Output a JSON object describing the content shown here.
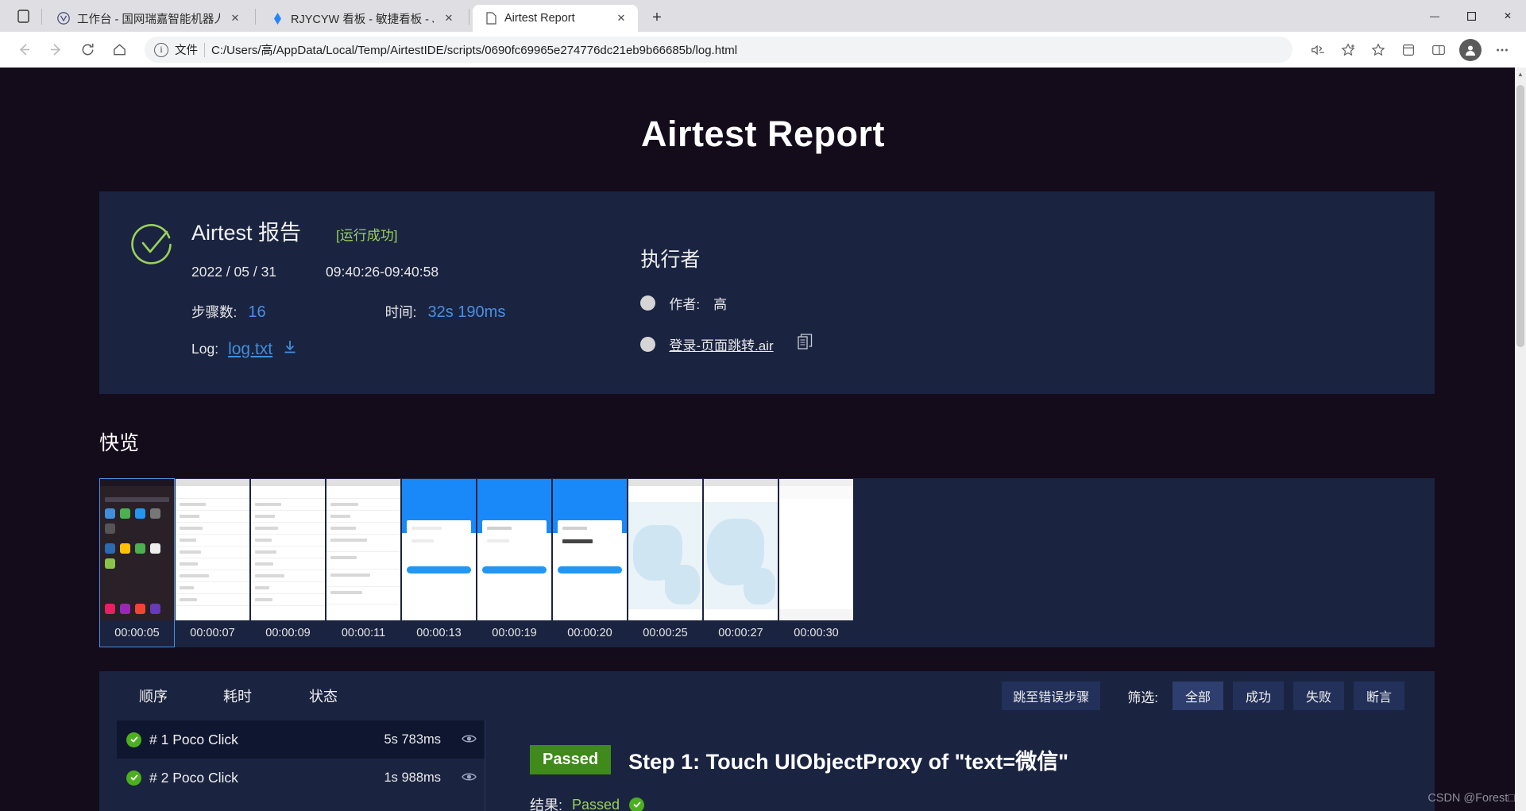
{
  "browser": {
    "tabs": [
      {
        "title": "工作台 - 国网瑞嘉智能机器人云平",
        "active": false,
        "favicon": "vue-logo-icon"
      },
      {
        "title": "RJYCYW 看板 - 敏捷看板 - Jira",
        "active": false,
        "favicon": "jira-logo-icon"
      },
      {
        "title": "Airtest Report",
        "active": true,
        "favicon": "page-icon"
      }
    ],
    "new_tab_label": "+",
    "window_controls": {
      "minimize": "—",
      "maximize": "☐",
      "close": "✕"
    },
    "omnibox": {
      "scheme_label": "文件",
      "url": "C:/Users/高/AppData/Local/Temp/AirtestIDE/scripts/0690fc69965e274776dc21eb9b66685b/log.html"
    },
    "nav": {
      "back": "←",
      "forward": "→",
      "reload": "↻",
      "home": "⌂"
    }
  },
  "report": {
    "page_title": "Airtest Report",
    "summary": {
      "title": "Airtest 报告",
      "status": "[运行成功]",
      "date": "2022 / 05 / 31",
      "time_range": "09:40:26-09:40:58",
      "steps_label": "步骤数:",
      "steps_value": "16",
      "duration_label": "时间:",
      "duration_value": "32s 190ms",
      "log_label": "Log:",
      "log_file": "log.txt",
      "download_icon": "download-icon",
      "check_icon": "success-check-icon"
    },
    "executor": {
      "title": "执行者",
      "author_label": "作者:",
      "author_value": "高",
      "script_name": "登录-页面跳转.air",
      "copy_icon": "copy-icon"
    }
  },
  "snapshot": {
    "title": "快览",
    "thumbs": [
      {
        "time": "00:00:05",
        "kind": "home",
        "active": true
      },
      {
        "time": "00:00:07",
        "kind": "list",
        "active": false
      },
      {
        "time": "00:00:09",
        "kind": "list",
        "active": false
      },
      {
        "time": "00:00:11",
        "kind": "list2",
        "active": false
      },
      {
        "time": "00:00:13",
        "kind": "blue",
        "active": false
      },
      {
        "time": "00:00:19",
        "kind": "blue",
        "active": false
      },
      {
        "time": "00:00:20",
        "kind": "blue",
        "active": false
      },
      {
        "time": "00:00:25",
        "kind": "map",
        "active": false
      },
      {
        "time": "00:00:27",
        "kind": "map",
        "active": false
      },
      {
        "time": "00:00:30",
        "kind": "white",
        "active": false
      }
    ]
  },
  "steps": {
    "columns": {
      "order": "顺序",
      "duration": "耗时",
      "status": "状态"
    },
    "jump_to_error": "跳至错误步骤",
    "filter_label": "筛选:",
    "filters": [
      {
        "label": "全部",
        "active": true
      },
      {
        "label": "成功",
        "active": false
      },
      {
        "label": "失败",
        "active": false
      },
      {
        "label": "断言",
        "active": false
      }
    ],
    "items": [
      {
        "name": "# 1 Poco Click",
        "time": "5s 783ms",
        "status": "passed",
        "selected": true,
        "eye_icon": "eye-icon"
      },
      {
        "name": "# 2 Poco Click",
        "time": "1s 988ms",
        "status": "passed",
        "selected": false,
        "eye_icon": "eye-icon"
      }
    ],
    "detail": {
      "badge": "Passed",
      "title": "Step 1: Touch UIObjectProxy of \"text=微信\"",
      "result_label": "结果:",
      "result_value": "Passed",
      "result_icon": "success-check-icon"
    }
  },
  "watermark": "CSDN @Forest□",
  "colors": {
    "page_bg": "#140b1b",
    "panel_bg": "#1a2340",
    "accent_blue": "#4a90e2",
    "success_green": "#9ad15a",
    "badge_green": "#3f8a1b"
  }
}
